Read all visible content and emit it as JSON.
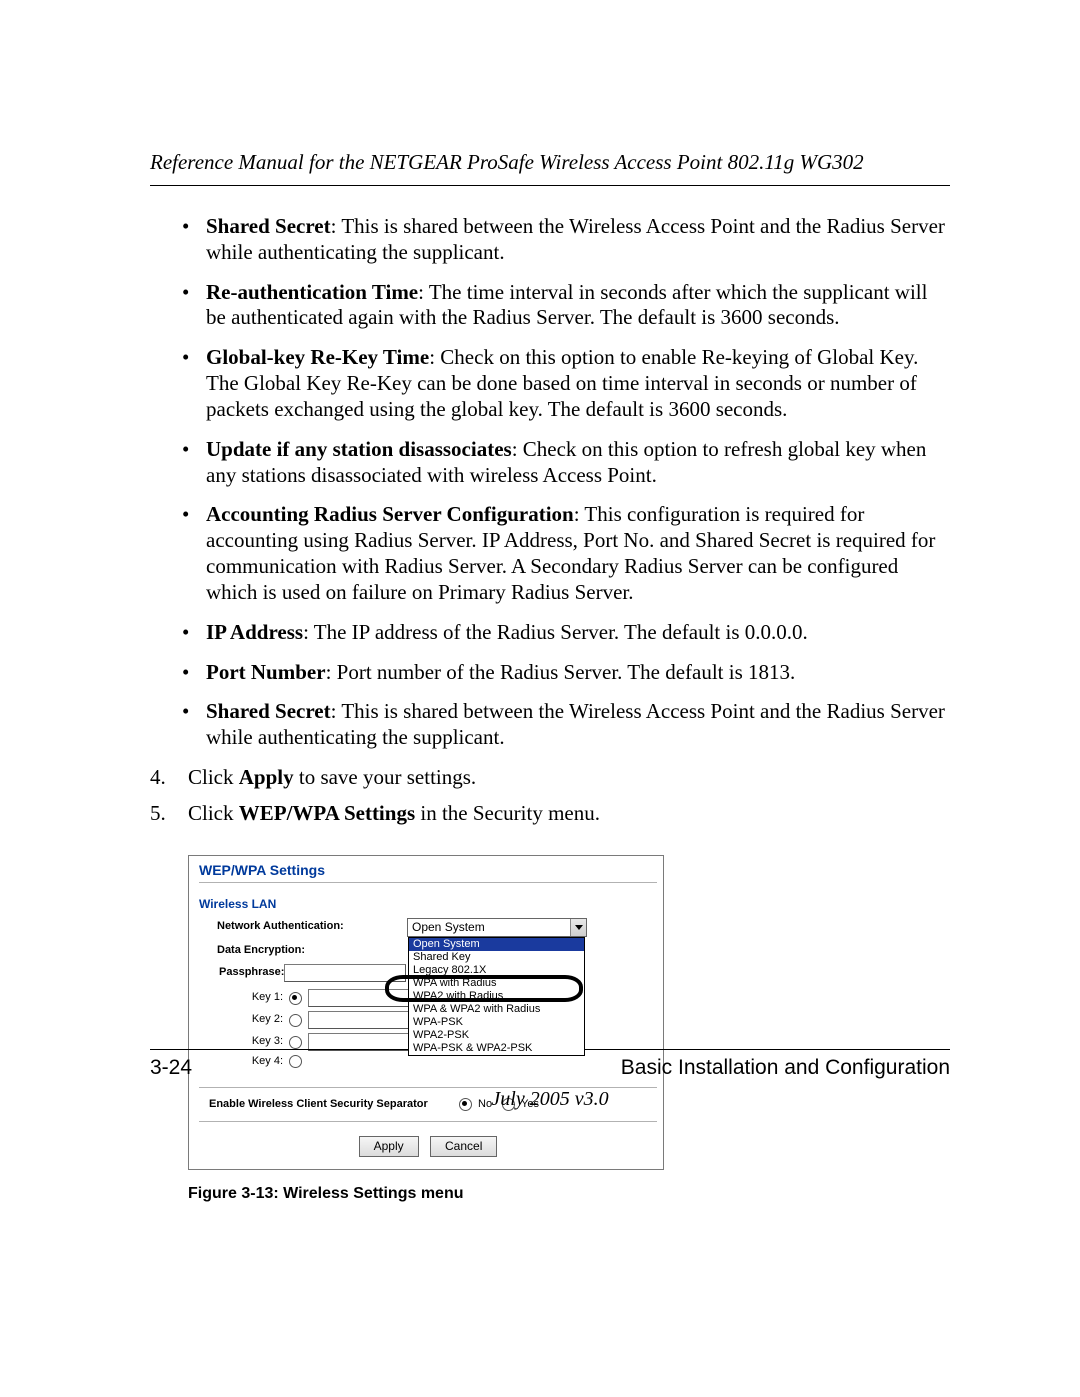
{
  "header": {
    "running_title": "Reference Manual for the NETGEAR ProSafe Wireless Access Point 802.11g WG302"
  },
  "bullets": [
    {
      "term": "Shared Secret",
      "text": ": This is shared between the Wireless Access Point and the Radius Server while authenticating the supplicant."
    },
    {
      "term": "Re-authentication Time",
      "text": ": The time interval in seconds after which the supplicant will be authenticated again with the Radius Server. The default is 3600 seconds."
    },
    {
      "term": "Global-key Re-Key Time",
      "text": ": Check on this option to enable Re-keying of Global Key. The Global Key Re-Key can be done based on time interval in seconds or number of packets exchanged using the global key. The default is 3600 seconds."
    },
    {
      "term": "Update if any station disassociates",
      "text": ": Check on this option to refresh global key when any stations disassociated with wireless Access Point."
    },
    {
      "term": "Accounting Radius Server Configuration",
      "text": ": This configuration is required for accounting using Radius Server. IP Address, Port No. and Shared Secret is required for communication with Radius Server. A Secondary Radius Server can be configured which is used on failure on Primary Radius Server."
    },
    {
      "term": "IP Address",
      "text": ": The IP address of the Radius Server. The default is 0.0.0.0."
    },
    {
      "term": "Port Number",
      "text": ": Port number of the Radius Server. The default is 1813."
    },
    {
      "term": "Shared Secret",
      "text": ": This is shared between the Wireless Access Point and the Radius Server while authenticating the supplicant."
    }
  ],
  "steps": [
    {
      "pre": "Click ",
      "strong": "Apply",
      "post": " to save your settings."
    },
    {
      "pre": "Click ",
      "strong": "WEP/WPA Settings",
      "post": " in the Security menu."
    }
  ],
  "figure": {
    "panel_title": "WEP/WPA Settings",
    "wlan_title": "Wireless LAN",
    "rows": {
      "network_auth_label": "Network Authentication:",
      "data_encryption_label": "Data Encryption:",
      "passphrase_label": "Passphrase:",
      "key1_label": "Key 1:",
      "key2_label": "Key 2:",
      "key3_label": "Key 3:",
      "key4_label": "Key 4:"
    },
    "select_current": "Open System",
    "dropdown_options": [
      "Open System",
      "Shared Key",
      "Legacy 802.1X",
      "WPA with Radius",
      "WPA2 with Radius",
      "WPA & WPA2 with Radius",
      "WPA-PSK",
      "WPA2-PSK",
      "WPA-PSK & WPA2-PSK"
    ],
    "separator_label": "Enable Wireless Client Security Separator",
    "separator_no": "No",
    "separator_yes": "Yes",
    "apply_button": "Apply",
    "cancel_button": "Cancel",
    "caption": "Figure 3-13:  Wireless Settings menu"
  },
  "footer": {
    "page_number": "3-24",
    "section_title": "Basic Installation and Configuration",
    "version_line": "July 2005 v3.0"
  }
}
